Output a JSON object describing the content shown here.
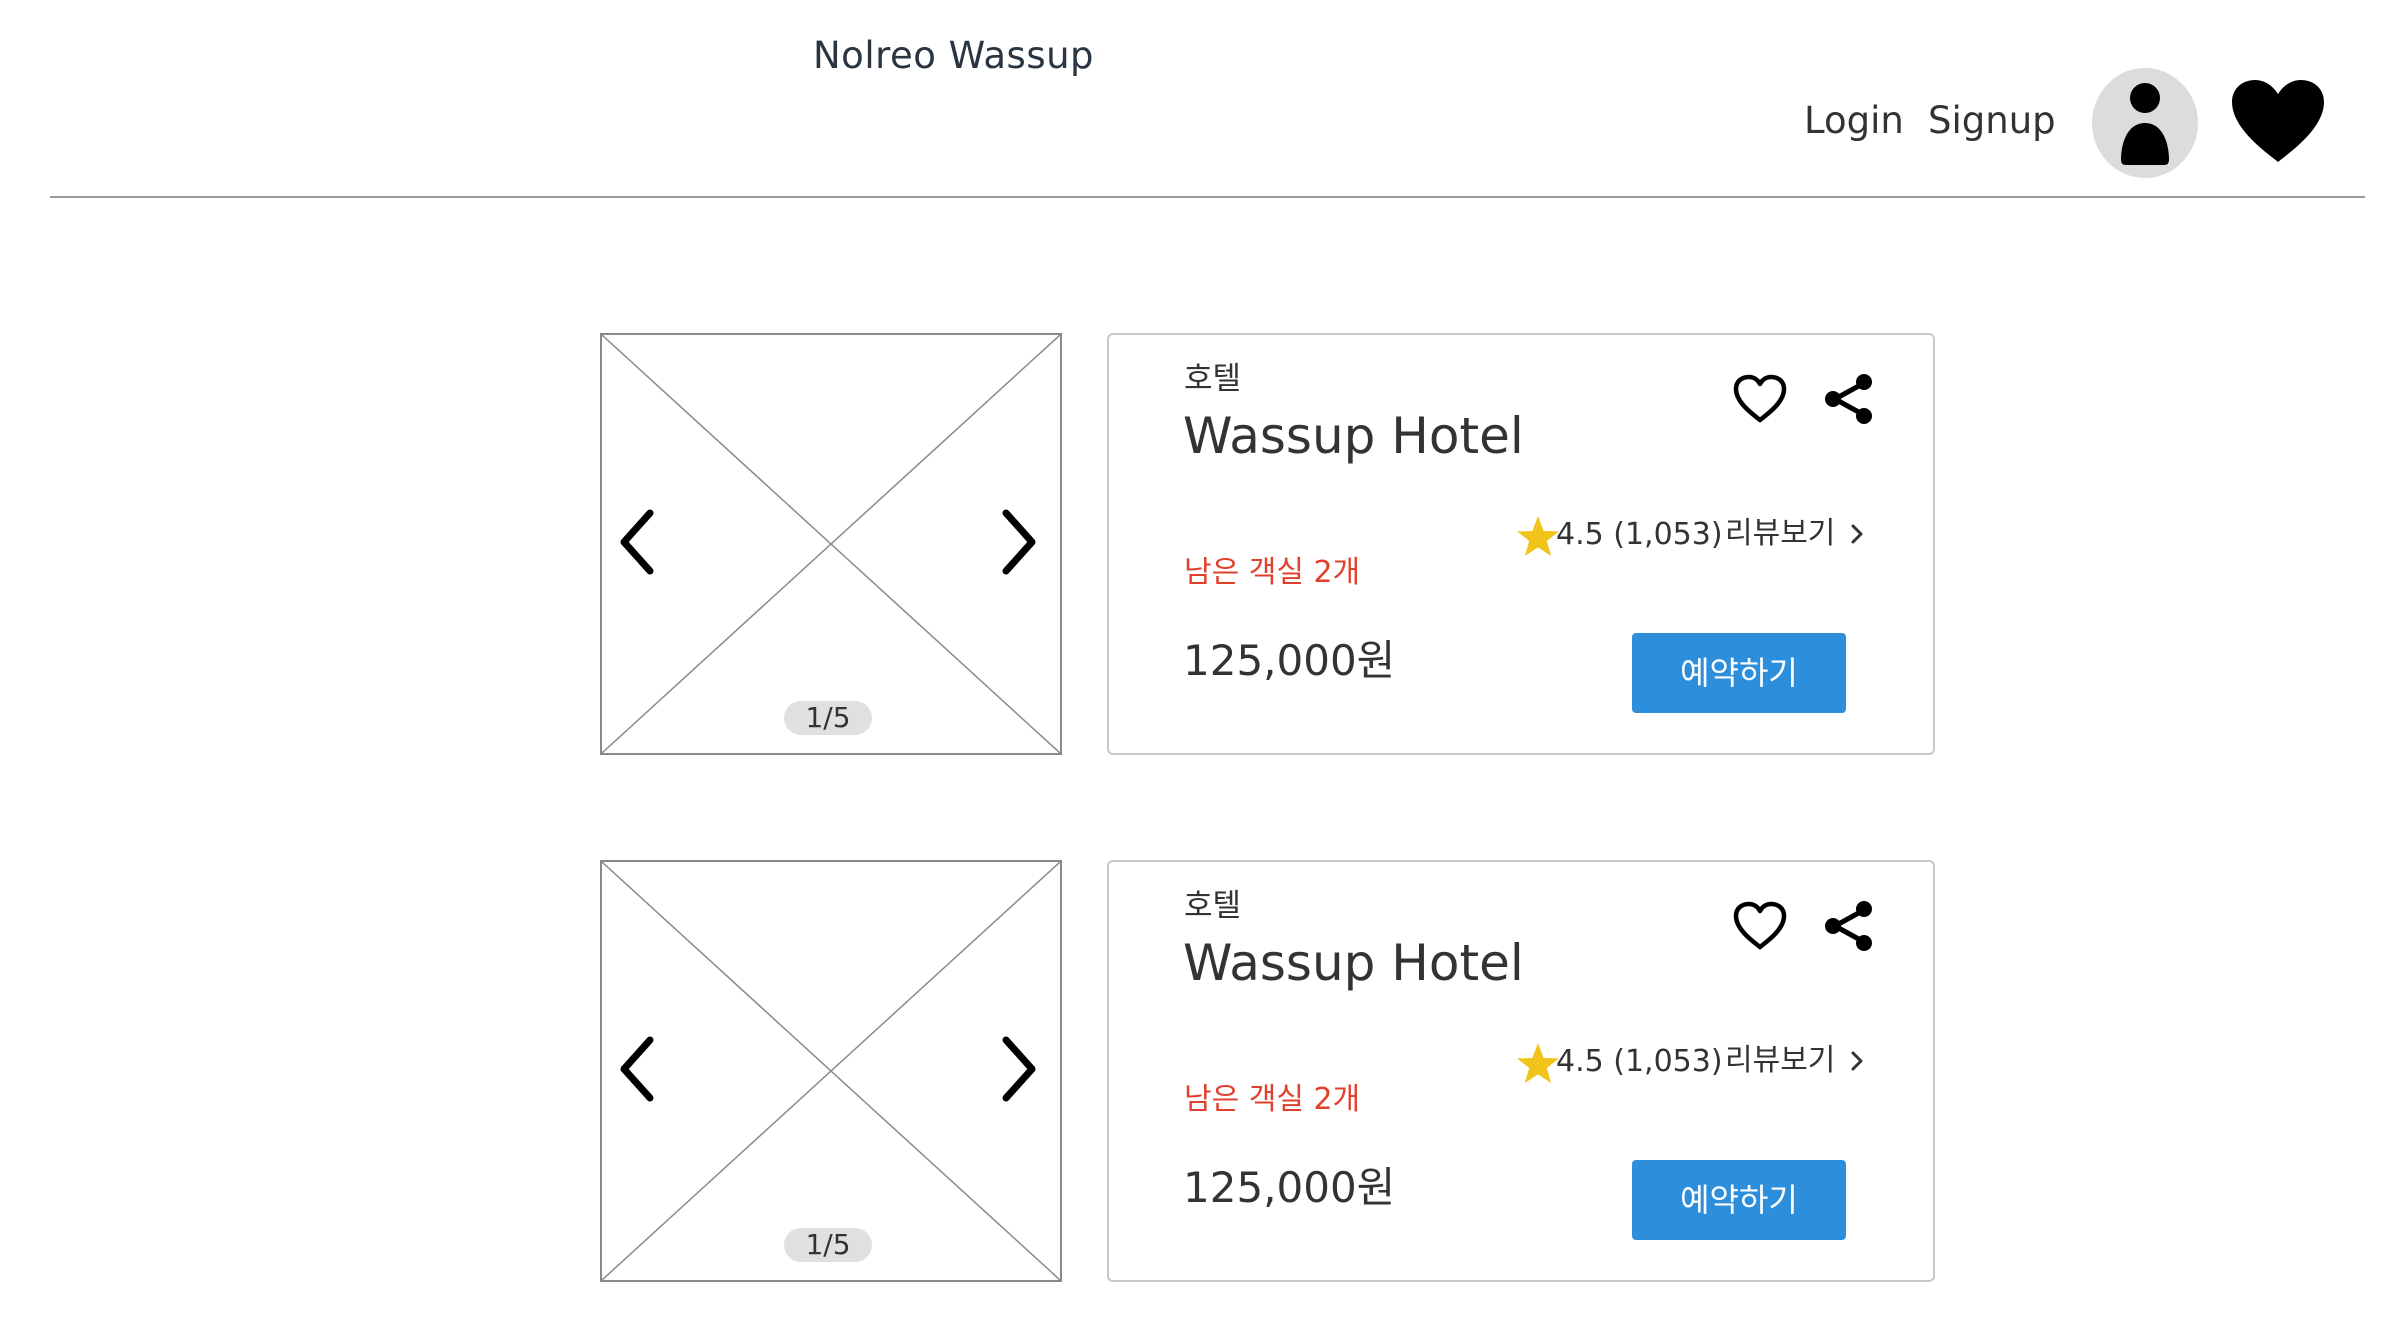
{
  "header": {
    "title": "Nolreo Wassup",
    "login_label": "Login",
    "signup_label": "Signup"
  },
  "icons": {
    "avatar": "user-avatar-icon",
    "wishlist": "heart-filled-icon",
    "favorite": "heart-outline-icon",
    "share": "share-icon",
    "rating": "star-icon",
    "prev": "chevron-left-icon",
    "next": "chevron-right-icon",
    "review_more": "chevron-right-small-icon"
  },
  "colors": {
    "primary_button": "#2d8fdc",
    "rooms_left_text": "#e0402c",
    "star": "#f0c419",
    "avatar_bg": "#dcdcdc"
  },
  "listings": [
    {
      "image_counter": "1/5",
      "category": "호텔",
      "name": "Wassup Hotel",
      "rating_text": "4.5 (1,053)",
      "review_label": "리뷰보기",
      "rooms_left": "남은 객실 2개",
      "price": "125,000원",
      "book_label": "예약하기"
    },
    {
      "image_counter": "1/5",
      "category": "호텔",
      "name": "Wassup Hotel",
      "rating_text": "4.5 (1,053)",
      "review_label": "리뷰보기",
      "rooms_left": "남은 객실 2개",
      "price": "125,000원",
      "book_label": "예약하기"
    }
  ]
}
